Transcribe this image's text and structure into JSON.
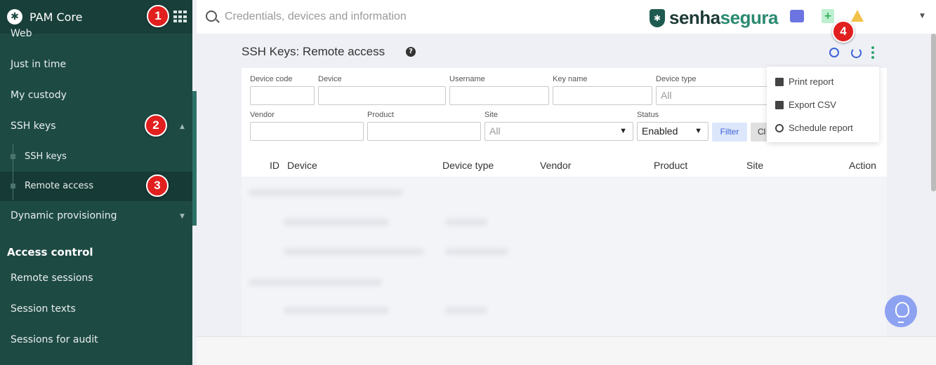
{
  "app": {
    "title": "PAM Core"
  },
  "search": {
    "placeholder": "Credentials, devices and information"
  },
  "brand": {
    "part1": "senha",
    "part2": "segura"
  },
  "sidebar": {
    "items": [
      {
        "label": "Web"
      },
      {
        "label": "Just in time"
      },
      {
        "label": "My custody"
      },
      {
        "label": "SSH keys"
      },
      {
        "label": "SSH keys"
      },
      {
        "label": "Remote access"
      },
      {
        "label": "Dynamic provisioning"
      }
    ],
    "section": "Access control",
    "section_items": [
      {
        "label": "Remote sessions"
      },
      {
        "label": "Session texts"
      },
      {
        "label": "Sessions for audit"
      }
    ]
  },
  "page": {
    "title": "SSH Keys: Remote access"
  },
  "filters": {
    "device_code": "Device code",
    "device": "Device",
    "username": "Username",
    "key_name": "Key name",
    "device_type": "Device type",
    "device_type_value": "All",
    "vendor": "Vendor",
    "product": "Product",
    "site": "Site",
    "site_value": "All",
    "status": "Status",
    "status_value": "Enabled",
    "filter_btn": "Filter",
    "clear_btn": "Cl"
  },
  "table": {
    "columns": [
      "ID",
      "Device",
      "Device type",
      "Vendor",
      "Product",
      "Site",
      "Action"
    ]
  },
  "dropdown": {
    "items": [
      {
        "label": "Print report",
        "icon": "printer-icon"
      },
      {
        "label": "Export CSV",
        "icon": "file-icon"
      },
      {
        "label": "Schedule report",
        "icon": "clock-icon"
      }
    ]
  },
  "callouts": [
    "1",
    "2",
    "3",
    "4"
  ],
  "colors": {
    "sidebar": "#1e4a44",
    "accent": "#3b62d8",
    "callout": "#e11f1f"
  }
}
